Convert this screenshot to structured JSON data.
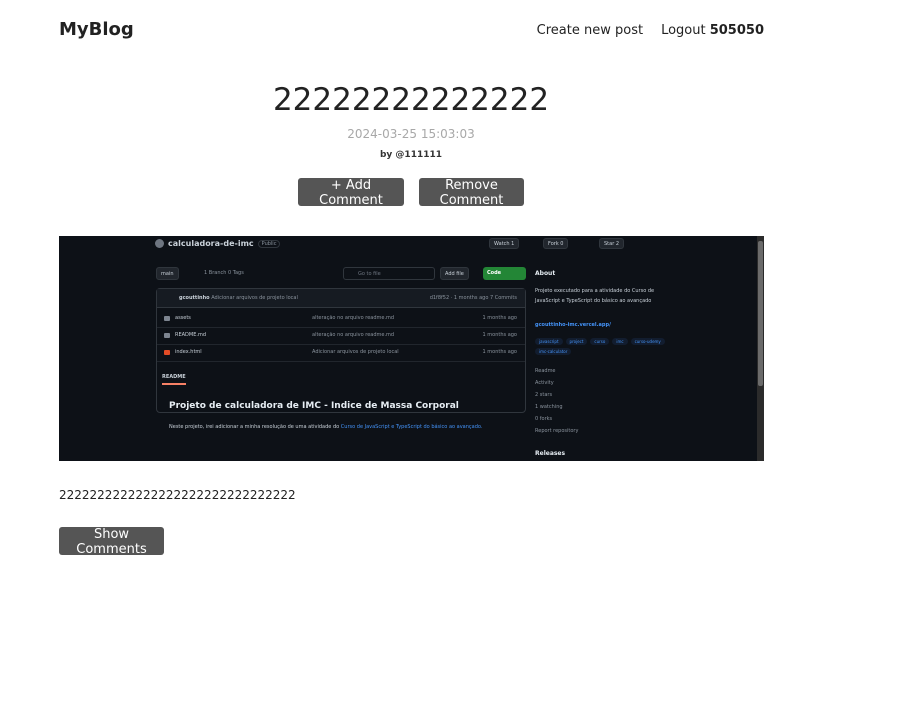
{
  "header": {
    "logo": "MyBlog",
    "create_post": "Create new post",
    "logout_label": "Logout",
    "username": "505050"
  },
  "post": {
    "title": "22222222222222",
    "date": "2024-03-25 15:03:03",
    "author": "by @111111",
    "body": "2222222222222222222222222222222"
  },
  "buttons": {
    "add_comment": "+ Add Comment",
    "remove_comment": "Remove Comment",
    "show_comments": "Show Comments"
  },
  "cover": {
    "repo_name": "calculadora-de-imc",
    "visibility": "Public",
    "watch": "Watch 1",
    "fork": "Fork 0",
    "star": "Star 2",
    "branch": "main",
    "branch_meta": "1 Branch   0 Tags",
    "go_to_file": "Go to file",
    "add_file": "Add file",
    "code": "Code",
    "commit_author": "gcouttinho",
    "commit_msg": "Adicionar arquivos de projeto local",
    "commit_meta": "d1f8f52 · 1 months ago   7 Commits",
    "files": [
      {
        "name": "assets",
        "msg": "alteração no arquivo readme.md",
        "time": "1 months ago",
        "type": "folder"
      },
      {
        "name": "README.md",
        "msg": "alteração no arquivo readme.md",
        "time": "1 months ago",
        "type": "file"
      },
      {
        "name": "index.html",
        "msg": "Adicionar arquivos de projeto local",
        "time": "1 months ago",
        "type": "html"
      }
    ],
    "readme_tab": "README",
    "readme_title": "Projeto de calculadora de IMC - Indice de Massa Corporal",
    "readme_text": "Neste projeto, irei adicionar a minha resolução de uma atividade do ",
    "readme_link": "Curso de JavaScript e TypeScript do básico ao avançado.",
    "about_title": "About",
    "about_text": "Projeto executado para a atividade do Curso de JavaScript e TypeScript do básico ao avançado",
    "about_link": "gcouttinho-imc.vercel.app/",
    "tags": [
      "javascript",
      "project",
      "curso",
      "imc",
      "curso-udemy",
      "imc-calculator"
    ],
    "side_items": [
      "Readme",
      "Activity",
      "2 stars",
      "1 watching",
      "0 forks",
      "Report repository"
    ],
    "releases": "Releases"
  }
}
